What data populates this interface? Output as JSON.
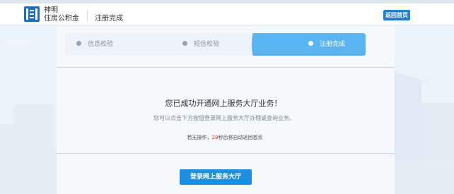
{
  "header": {
    "logo_line1": "神明",
    "logo_line2": "住房公积金",
    "title": "注册完成",
    "home_button": "返回首页"
  },
  "steps": [
    {
      "label": "信息校验",
      "state": "done"
    },
    {
      "label": "短信校验",
      "state": "done"
    },
    {
      "label": "注册完成",
      "state": "active"
    }
  ],
  "result": {
    "title": "您已成功开通网上服务大厅业务！",
    "description": "您可以点击下方按钮登录网上服务大厅办理或查询业务。",
    "countdown_prefix": "若无操作，",
    "countdown_seconds": "28",
    "countdown_suffix": "秒后将自动返回首页"
  },
  "login_button": "登录网上服务大厅",
  "colors": {
    "accent": "#5ab4f0",
    "button": "#1f8fdd",
    "brand": "#1f7fd0",
    "countdown_number": "#e03b2b"
  }
}
